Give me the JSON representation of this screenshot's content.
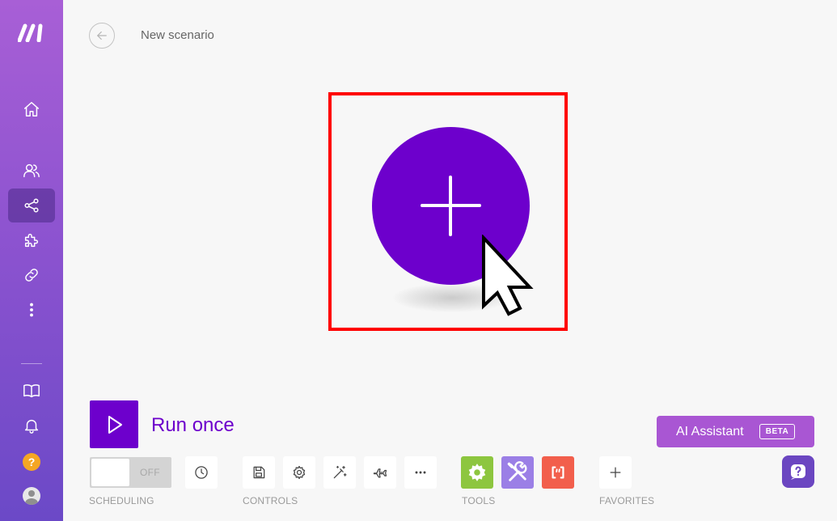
{
  "header": {
    "title": "New scenario"
  },
  "sidebar": {
    "items": [
      {
        "name": "home",
        "icon": "home-icon"
      },
      {
        "name": "team",
        "icon": "users-icon"
      },
      {
        "name": "scenarios",
        "icon": "share-nodes-icon",
        "active": true
      },
      {
        "name": "apps",
        "icon": "puzzle-icon"
      },
      {
        "name": "connections",
        "icon": "link-icon"
      },
      {
        "name": "more",
        "icon": "dots-vertical-icon"
      },
      {
        "name": "docs",
        "icon": "book-icon"
      },
      {
        "name": "notifications",
        "icon": "bell-icon"
      },
      {
        "name": "help",
        "icon": "help-icon",
        "text": "?"
      },
      {
        "name": "profile",
        "icon": "avatar-icon"
      }
    ]
  },
  "run": {
    "label": "Run once"
  },
  "scheduling": {
    "toggle_state": "OFF",
    "label": "SCHEDULING"
  },
  "controls": {
    "label": "CONTROLS"
  },
  "tools": {
    "label": "TOOLS"
  },
  "favorites": {
    "label": "FAVORITES"
  },
  "ai_assistant": {
    "label": "AI Assistant",
    "badge": "BETA"
  },
  "colors": {
    "accent": "#6d00cc",
    "sidebar_top": "#a85fd6",
    "sidebar_bottom": "#6b49c7",
    "highlight": "#ff0000",
    "tool_flow_control": "#8dc63f",
    "tool_tools": "#9b7fe6",
    "tool_text_parser": "#f25f4c",
    "ai_button": "#a956d3",
    "chat_button": "#6b46c1"
  }
}
